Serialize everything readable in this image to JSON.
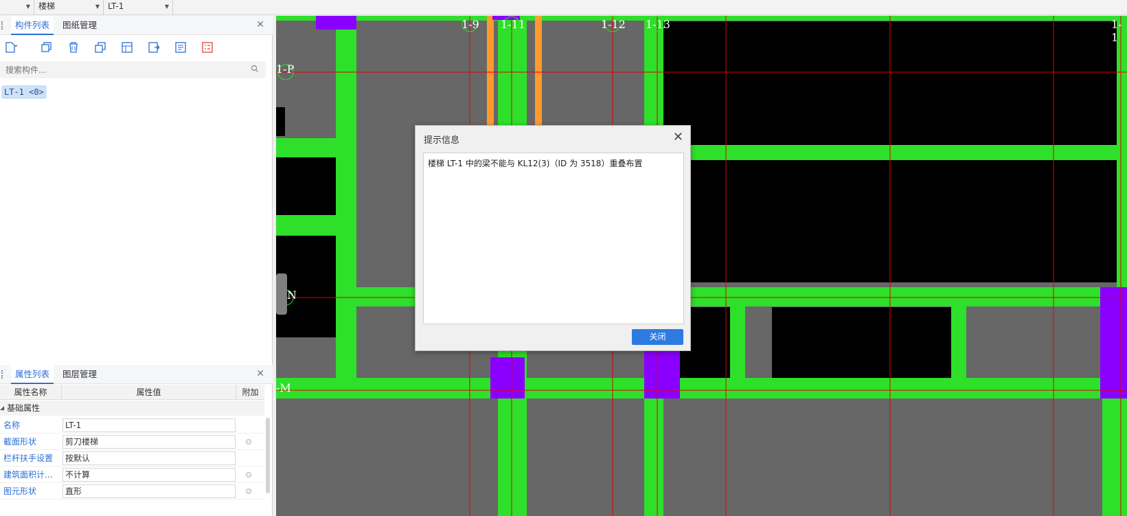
{
  "toolbar": {
    "combo1": "",
    "combo2": "楼梯",
    "combo3": "LT-1"
  },
  "components_panel": {
    "tab_active": "构件列表",
    "tab_other": "图纸管理",
    "search_placeholder": "搜索构件...",
    "items": [
      "LT-1 <0>"
    ]
  },
  "properties_panel": {
    "tab_active": "属性列表",
    "tab_other": "图层管理",
    "col_name": "属性名称",
    "col_value": "属性值",
    "col_extra": "附加",
    "group": "基础属性",
    "rows": [
      {
        "name": "名称",
        "value": "LT-1"
      },
      {
        "name": "截面形状",
        "value": "剪刀楼梯"
      },
      {
        "name": "栏杆扶手设置",
        "value": "按默认"
      },
      {
        "name": "建筑面积计...",
        "value": "不计算"
      },
      {
        "name": "图元形状",
        "value": "直形"
      }
    ]
  },
  "canvas": {
    "axis_labels": {
      "a1": "1-9",
      "a2": "1-11",
      "a3": "1-12",
      "a4": "1-13",
      "a5": "1-1",
      "b1": "1-P",
      "b2": "N",
      "b3": "-M"
    }
  },
  "dialog": {
    "title": "提示信息",
    "message": "楼梯 LT-1 中的梁不能与 KL12(3)（ID 为 3518）重叠布置",
    "close_button": "关闭"
  },
  "colors": {
    "beam_green": "#2ee02a",
    "slab_black": "#000000",
    "column_purple": "#8a00ff",
    "axis_red": "#e00000",
    "orange": "#ff9a2e",
    "accent_blue": "#2d7be0"
  }
}
